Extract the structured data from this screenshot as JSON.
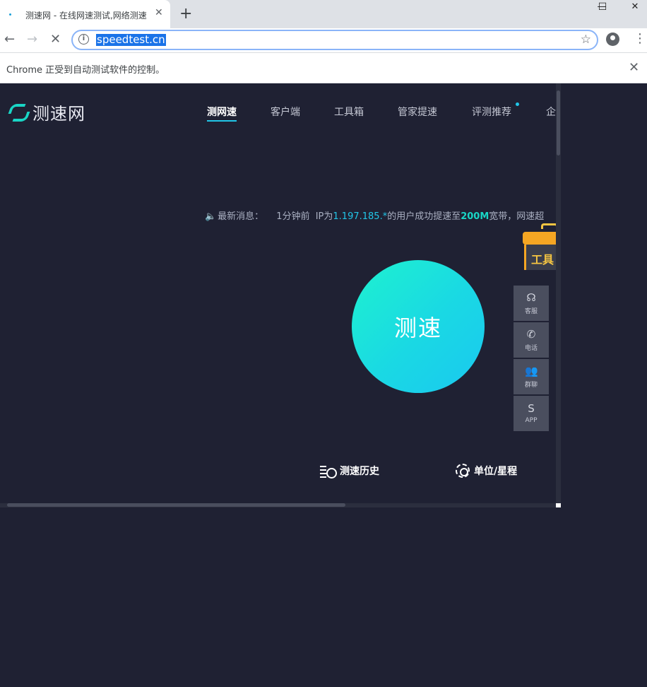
{
  "browser": {
    "tab_title": "测速网 - 在线网速测试,网络测速",
    "tab_close": "✕",
    "new_tab": "+",
    "url": "speedtest.cn",
    "info_icon": "i",
    "bookmark_icon": "☆",
    "menu_icon": "⋮",
    "back_icon": "←",
    "forward_icon": "→",
    "stop_icon": "✕",
    "win_min": "—",
    "win_max": "☐",
    "win_close": "✕",
    "automation_msg": "Chrome 正受到自动测试软件的控制。",
    "automation_close": "✕"
  },
  "site": {
    "logo_text": "测速网",
    "nav": [
      "测网速",
      "客户端",
      "工具箱",
      "管家提速",
      "评测推荐",
      "企"
    ],
    "news": {
      "speaker_icon": "🔈",
      "label": "最新消息：",
      "time": "1分钟前",
      "ip_prefix": "IP为",
      "ip": "1.197.185.*",
      "mid": "的用户成功提速至",
      "bandwidth": "200M",
      "suffix": "宽带，网速超"
    },
    "speed_button": "测速",
    "toolbox_label": "工具",
    "side_buttons": [
      {
        "icon": "☊",
        "label": "客服"
      },
      {
        "icon": "✆",
        "label": "电话"
      },
      {
        "icon": "👥",
        "label": "群聊"
      },
      {
        "icon": "S",
        "label": "APP"
      }
    ],
    "history_label": "测速历史",
    "unit_label": "单位/星程"
  },
  "colors": {
    "page_bg": "#1f2133",
    "accent": "#21c6e8",
    "button_gradient_start": "#1ef2cf",
    "button_gradient_end": "#1ac8f0"
  }
}
